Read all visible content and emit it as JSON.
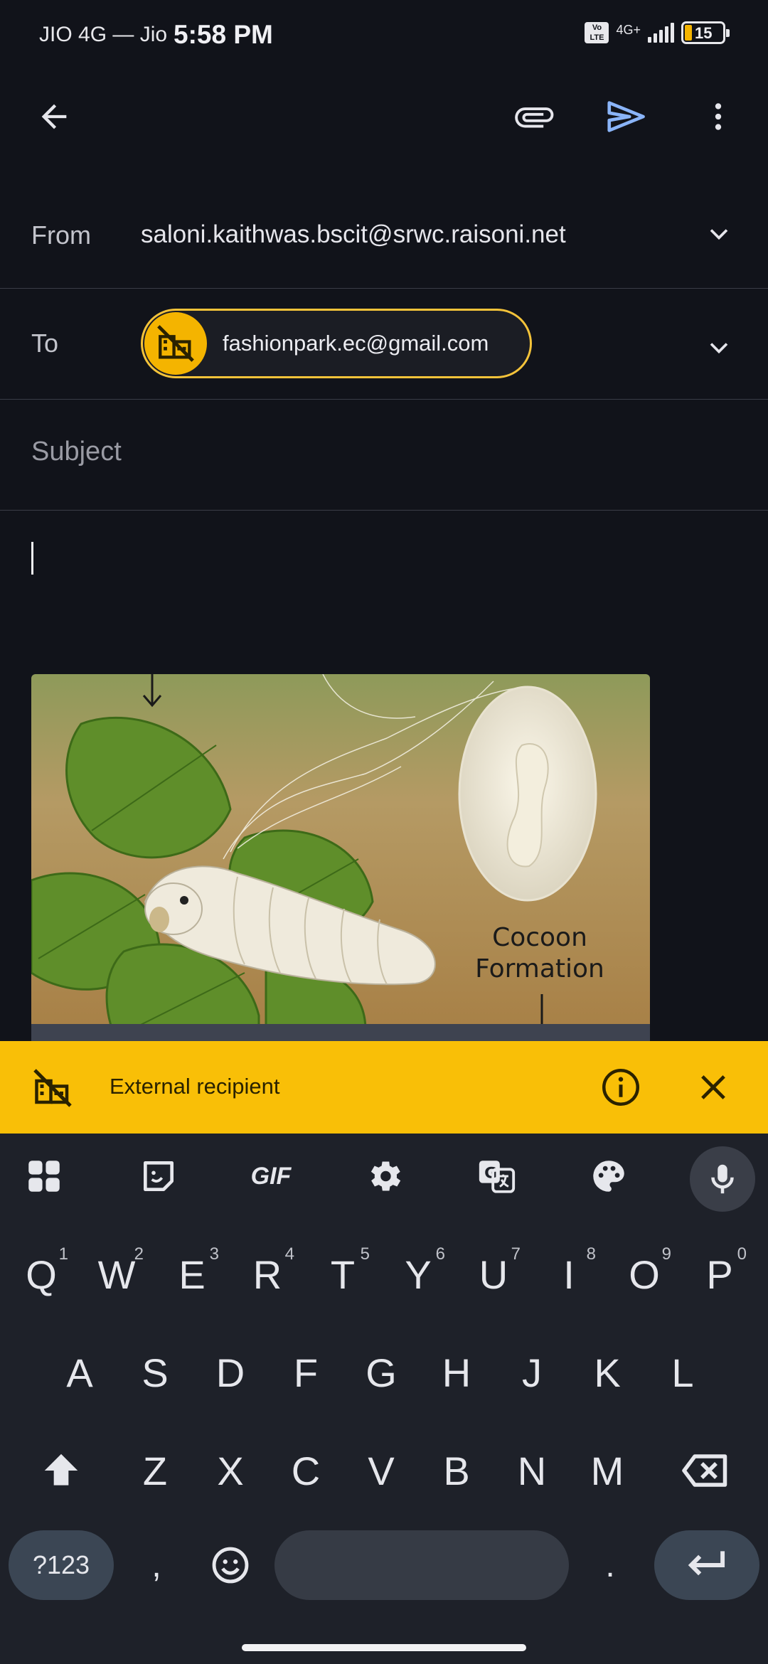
{
  "status": {
    "carrier": "JIO 4G — Jio",
    "time": "5:58 PM",
    "volte": "Vo LTE",
    "network": "4G+",
    "battery": "15"
  },
  "compose": {
    "from_label": "From",
    "from_value": "saloni.kaithwas.bscit@srwc.raisoni.net",
    "to_label": "To",
    "to_recipient": "fashionpark.ec@gmail.com",
    "subject_placeholder": "Subject",
    "image_caption_line1": "Cocoon",
    "image_caption_line2": "Formation"
  },
  "banner": {
    "text": "External recipient"
  },
  "keyboard": {
    "row1": [
      {
        "k": "Q",
        "n": "1"
      },
      {
        "k": "W",
        "n": "2"
      },
      {
        "k": "E",
        "n": "3"
      },
      {
        "k": "R",
        "n": "4"
      },
      {
        "k": "T",
        "n": "5"
      },
      {
        "k": "Y",
        "n": "6"
      },
      {
        "k": "U",
        "n": "7"
      },
      {
        "k": "I",
        "n": "8"
      },
      {
        "k": "O",
        "n": "9"
      },
      {
        "k": "P",
        "n": "0"
      }
    ],
    "row2": [
      "A",
      "S",
      "D",
      "F",
      "G",
      "H",
      "J",
      "K",
      "L"
    ],
    "row3": [
      "Z",
      "X",
      "C",
      "V",
      "B",
      "N",
      "M"
    ],
    "symbols_label": "?123",
    "comma": ",",
    "period": ".",
    "gif_label": "GIF"
  },
  "colors": {
    "accent_send": "#8ab4f8",
    "banner_bg": "#f9bf07",
    "background": "#11131a"
  }
}
